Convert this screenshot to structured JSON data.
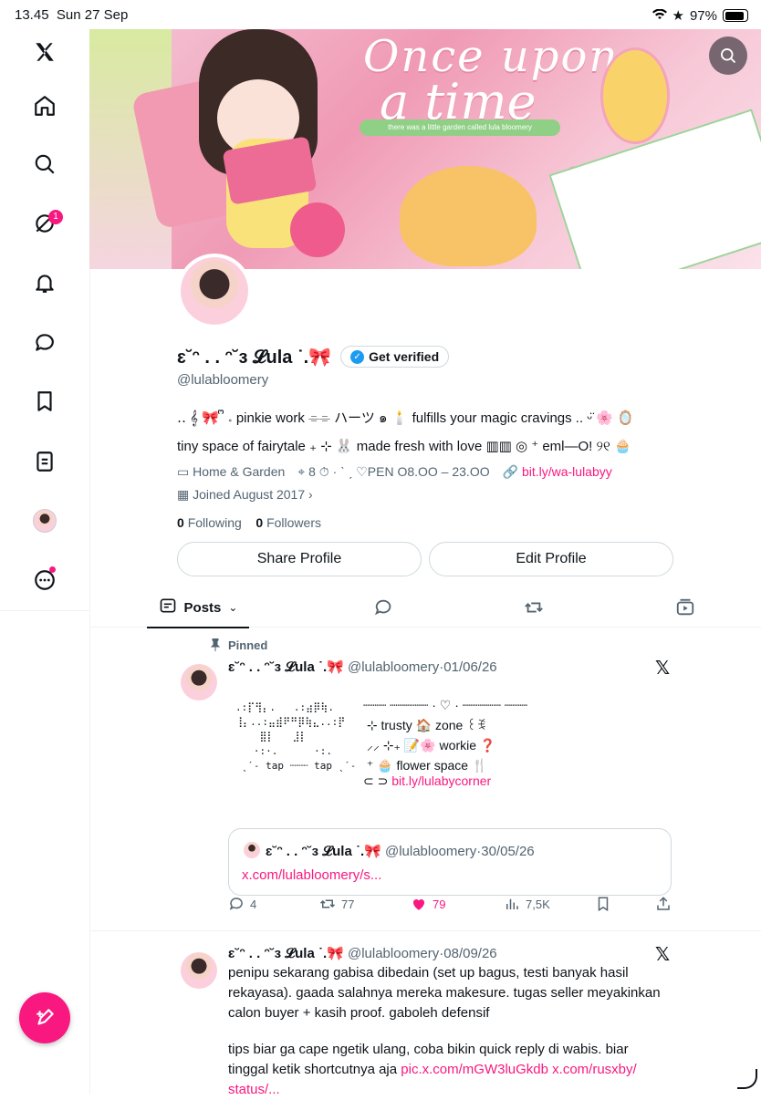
{
  "status_bar": {
    "time": "13.45",
    "date": "Sun 27 Sep",
    "battery": "97%"
  },
  "sidebar": {
    "messages_badge": "1"
  },
  "banner": {
    "line1": "Once upon",
    "line2": "a time",
    "ribbon": "there was a little garden called lula bloomery"
  },
  "profile": {
    "name": "ɛ˘ᵔ . . ᵔ˘ɜ 𝓛ula ˙.🎀",
    "get_verified": "Get verified",
    "handle": "@lulabloomery",
    "bio_line1": "‥ 𝄞 🎀 ᩚ 𝆹 pinkie work  ⌯⌯  ハーツ ๑ 🕯️ fulfills your magic cravings .. ᵕ̈ 🌸 🪞",
    "bio_line2": "tiny space of fairytale ₊ ⊹ 🐰  made fresh with love  ▥▥ ◎ ⁺ eml—O!  ୨୧ 🧁",
    "category": "Home & Garden",
    "location": "8 ⏱ · ˋ ˏ ♡PEN O8.OO – 23.OO",
    "link": "bit.ly/wa-lulabyy",
    "joined": "Joined August 2017",
    "following_count": "0",
    "following_label": "Following",
    "followers_count": "0",
    "followers_label": "Followers",
    "share_button": "Share Profile",
    "edit_button": "Edit Profile"
  },
  "tabs": {
    "posts": "Posts"
  },
  "post1": {
    "pinned_label": "Pinned",
    "name": "ɛ˘ᵔ . . ᵔ˘ɜ 𝓛ula ˙.🎀",
    "handle": "@lulabloomery",
    "date": "01/06/26",
    "art_left": ".:⡏⢻⡄.   .:⣴⡿⢷.\n⢸⡄..:⣤⣾⠟⠛⡿⢷⣄..:⡟\n    ⣿⡇   ⣸⡇\n   ·:·.      ·:.\n ˎˊ˗ tap ┈┈┈ tap ˎˊ˗",
    "art_right": "┈┈┈ ┈┈┈┈┈ · ♡ · ┈┈┈┈┈ ┈┈┈\n ⊹ trusty 🏠 zone ꒰ꉂ\n ⸝⸝ ⊹₊ 📝🌸 workie ❓\n ⁺ 🧁 flower space 🍴",
    "art_link_prefix": "⊂ ⊃",
    "art_link": "bit.ly/lulabycorner",
    "quote_name": "ɛ˘ᵔ . . ᵔ˘ɜ 𝓛ula ˙.🎀",
    "quote_handle": "@lulabloomery",
    "quote_date": "30/05/26",
    "quote_link": "x.com/lulabloomery/s...",
    "replies": "4",
    "reposts": "77",
    "likes": "79",
    "views": "7,5K"
  },
  "post2": {
    "name": "ɛ˘ᵔ . . ᵔ˘ɜ 𝓛ula ˙.🎀",
    "handle": "@lulabloomery",
    "date": "08/09/26",
    "text1": "penipu sekarang gabisa dibedain (set up bagus, testi banyak hasil rekayasa). gaada salahnya mereka makesure. tugas seller meyakinkan calon buyer + kasih proof. gaboleh defensif",
    "text2": "tips biar ga cape ngetik ulang, coba bikin quick reply di wabis. biar tinggal ketik shortcutnya aja",
    "link1": "pic.x.com/mGW3luGkdb",
    "link2": "x.com/rusxby/ status/..."
  }
}
